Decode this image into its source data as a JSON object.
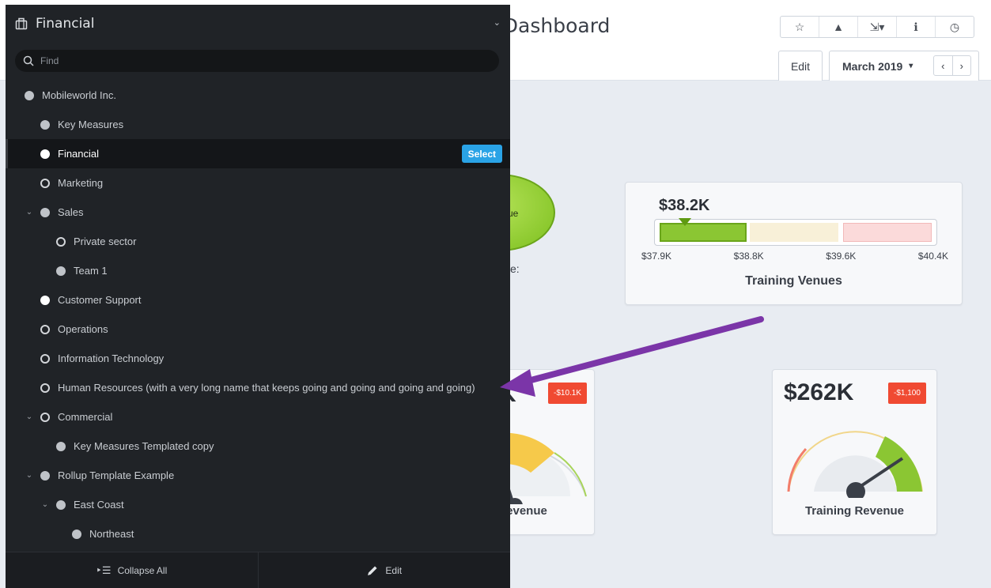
{
  "dashboard": {
    "title": "Overview Dashboard",
    "title_visible": "rview Dashboard",
    "toolbar": {
      "star_icon": "☆",
      "alert_icon": "▲",
      "export_icon": "⇲▾",
      "info_icon": "ℹ",
      "clock_icon": "◷"
    },
    "edit_tab": "Edit",
    "month_tab": "March 2019",
    "month_caret": "▾",
    "prev_arrow": "‹",
    "next_arrow": "›",
    "ellipse_text": "ue",
    "partial_label": "e:",
    "venues": {
      "value": "$38.2K",
      "ticks": [
        "$37.9K",
        "$38.8K",
        "$39.6K",
        "$40.4K"
      ],
      "title": "Training Venues"
    },
    "left_gauge": {
      "big": "K",
      "badge": "-$10.1K",
      "title": "t Revenue"
    },
    "right_gauge": {
      "big": "$262K",
      "badge": "-$1,100",
      "title": "Training Revenue"
    }
  },
  "panel": {
    "title": "Financial",
    "search_placeholder": "Find",
    "select_label": "Select",
    "items": [
      {
        "label": "Mobileworld Inc.",
        "indent": 0,
        "dot": "filled",
        "expander": ""
      },
      {
        "label": "Key Measures",
        "indent": 1,
        "dot": "filled",
        "expander": ""
      },
      {
        "label": "Financial",
        "indent": 1,
        "dot": "white",
        "expander": "",
        "selected": true
      },
      {
        "label": "Marketing",
        "indent": 1,
        "dot": "ring",
        "expander": ""
      },
      {
        "label": "Sales",
        "indent": 1,
        "dot": "filled",
        "expander": "⌄"
      },
      {
        "label": "Private sector",
        "indent": 2,
        "dot": "ring",
        "expander": ""
      },
      {
        "label": "Team 1",
        "indent": 2,
        "dot": "filled",
        "expander": ""
      },
      {
        "label": "Customer Support",
        "indent": 1,
        "dot": "white",
        "expander": ""
      },
      {
        "label": "Operations",
        "indent": 1,
        "dot": "ring",
        "expander": ""
      },
      {
        "label": "Information Technology",
        "indent": 1,
        "dot": "ring",
        "expander": ""
      },
      {
        "label": "Human Resources (with a very long name that keeps going and going and going and going)",
        "indent": 1,
        "dot": "ring",
        "expander": ""
      },
      {
        "label": "Commercial",
        "indent": 1,
        "dot": "ring",
        "expander": "⌄"
      },
      {
        "label": "Key Measures Templated copy",
        "indent": 2,
        "dot": "filled",
        "expander": ""
      },
      {
        "label": "Rollup Template Example",
        "indent": 1,
        "dot": "filled",
        "expander": "⌄"
      },
      {
        "label": "East Coast",
        "indent": 2,
        "dot": "filled",
        "expander": "⌄"
      },
      {
        "label": "Northeast",
        "indent": 3,
        "dot": "filled",
        "expander": ""
      }
    ],
    "footer": {
      "collapse_label": "Collapse All",
      "edit_label": "Edit"
    }
  },
  "colors": {
    "accent": "#2aa3e6",
    "arrow": "#7b35a8",
    "badge": "#f04a32",
    "good": "#8bc633"
  }
}
